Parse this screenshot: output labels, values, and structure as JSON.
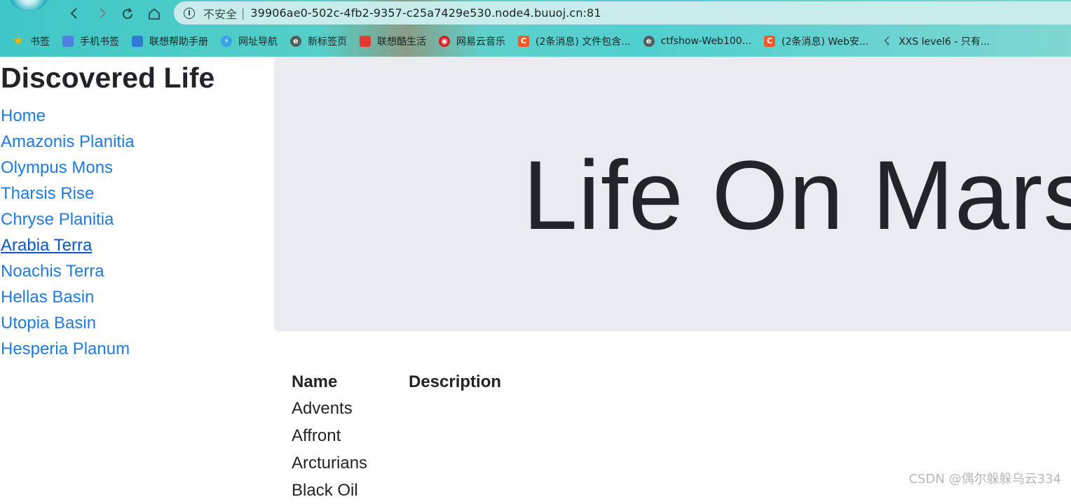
{
  "browser": {
    "security_label": "不安全",
    "separator": "|",
    "url": "39906ae0-502c-4fb2-9357-c25a7429e530.node4.buuoj.cn:81",
    "bookmarks": [
      {
        "label": "书签",
        "icon": "star-icon"
      },
      {
        "label": "手机书签",
        "icon": "phone-icon"
      },
      {
        "label": "联想帮助手册",
        "icon": "doc-icon"
      },
      {
        "label": "网址导航",
        "icon": "compass-icon"
      },
      {
        "label": "新标签页",
        "icon": "edge-icon"
      },
      {
        "label": "联想酷生活",
        "icon": "lenovo-icon"
      },
      {
        "label": "网易云音乐",
        "icon": "music-icon"
      },
      {
        "label": "(2条消息) 文件包含...",
        "icon": "csdn-icon"
      },
      {
        "label": "ctfshow-Web100...",
        "icon": "edge-icon"
      },
      {
        "label": "(2条消息) Web安...",
        "icon": "csdn-icon"
      },
      {
        "label": "XXS level6 - 只有...",
        "icon": "xxs-icon"
      }
    ]
  },
  "sidebar": {
    "title": "Discovered Life",
    "items": [
      {
        "label": "Home"
      },
      {
        "label": "Amazonis Planitia"
      },
      {
        "label": "Olympus Mons"
      },
      {
        "label": "Tharsis Rise"
      },
      {
        "label": "Chryse Planitia"
      },
      {
        "label": "Arabia Terra",
        "active": true
      },
      {
        "label": "Noachis Terra"
      },
      {
        "label": "Hellas Basin"
      },
      {
        "label": "Utopia Basin"
      },
      {
        "label": "Hesperia Planum"
      }
    ]
  },
  "hero": {
    "title": "Life On Mars"
  },
  "table": {
    "headers": [
      "Name",
      "Description"
    ],
    "rows": [
      [
        "Advents",
        ""
      ],
      [
        "Affront",
        ""
      ],
      [
        "Arcturians",
        ""
      ],
      [
        "Black Oil",
        ""
      ]
    ]
  },
  "watermark": "CSDN @偶尔躲躲乌云334",
  "colors": {
    "link": "#1e7be0",
    "active_link": "#0a58ca",
    "hero_bg": "#e9ecef",
    "text": "#212529"
  }
}
